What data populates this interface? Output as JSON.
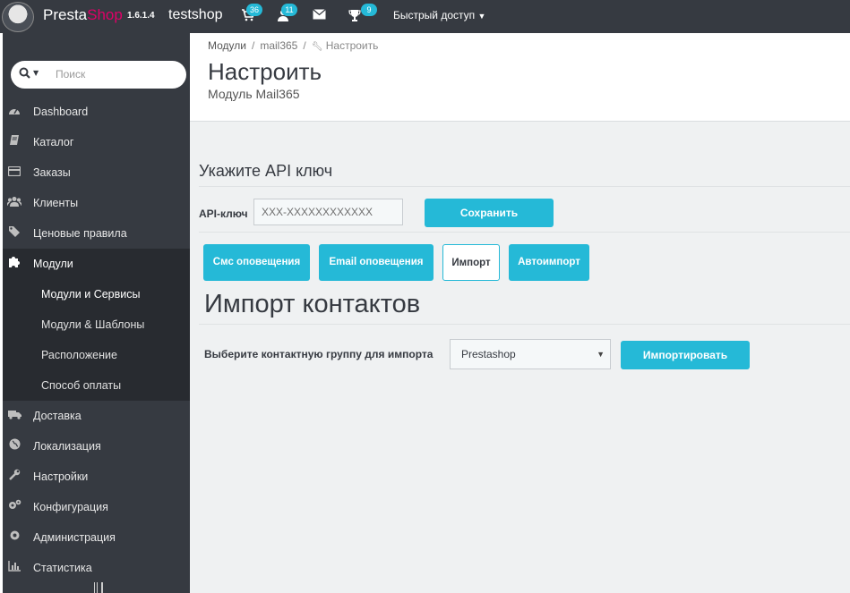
{
  "topbar": {
    "brand_part1": "Presta",
    "brand_part2": "Shop",
    "version": "1.6.1.4",
    "shop_name": "testshop",
    "cart_count": "36",
    "customers_count": "11",
    "trophy_count": "9",
    "quick_access": "Быстрый доступ"
  },
  "sidebar": {
    "search_placeholder": "Поиск",
    "items": [
      {
        "label": "Dashboard",
        "icon": "dashboard-icon"
      },
      {
        "label": "Каталог",
        "icon": "book-icon"
      },
      {
        "label": "Заказы",
        "icon": "credit-card-icon"
      },
      {
        "label": "Клиенты",
        "icon": "users-icon"
      },
      {
        "label": "Ценовые правила",
        "icon": "tags-icon"
      },
      {
        "label": "Модули",
        "icon": "puzzle-icon"
      }
    ],
    "subitems": [
      "Модули и Сервисы",
      "Модули & Шаблоны",
      "Расположение",
      "Способ оплаты"
    ],
    "items_after": [
      {
        "label": "Доставка",
        "icon": "truck-icon"
      },
      {
        "label": "Локализация",
        "icon": "globe-icon"
      },
      {
        "label": "Настройки",
        "icon": "wrench-icon"
      },
      {
        "label": "Конфигурация",
        "icon": "cogs-icon"
      },
      {
        "label": "Администрация",
        "icon": "gear-icon"
      },
      {
        "label": "Статистика",
        "icon": "bar-chart-icon"
      }
    ]
  },
  "header": {
    "breadcrumb": [
      "Модули",
      "mail365",
      "Настроить"
    ],
    "title": "Настроить",
    "subtitle": "Модуль Mail365"
  },
  "api": {
    "heading": "Укажите API ключ",
    "label": "API-ключ",
    "placeholder": "XXX-XXXXXXXXXXXX",
    "save_label": "Сохранить"
  },
  "tabs": [
    "Смс оповещения",
    "Email оповещения",
    "Импорт",
    "Автоимпорт"
  ],
  "import": {
    "heading": "Импорт контактов",
    "group_label": "Выберите контактную группу для импорта",
    "group_value": "Prestashop",
    "import_label": "Импортировать"
  },
  "colors": {
    "accent": "#25b9d7",
    "sidebar_bg": "#363a41",
    "active_bg": "#282b30",
    "brand_pink": "#df0067"
  }
}
